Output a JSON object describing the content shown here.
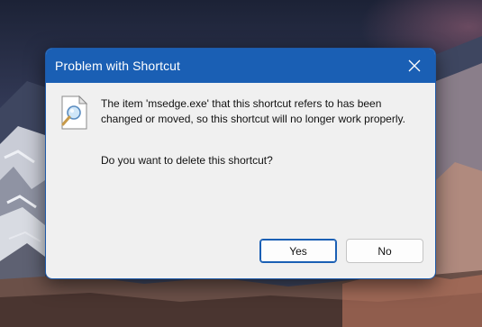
{
  "dialog": {
    "title": "Problem with Shortcut",
    "message": "The item 'msedge.exe' that this shortcut refers to has been changed or moved, so this shortcut will no longer work properly.",
    "question": "Do you want to delete this shortcut?",
    "buttons": {
      "yes": "Yes",
      "no": "No"
    },
    "icon": "missing-file-search-icon",
    "close_icon": "close-icon"
  },
  "colors": {
    "titlebar": "#1a5fb4",
    "dialog_background": "#f0f0f0",
    "default_button_border": "#1a5fb4"
  }
}
